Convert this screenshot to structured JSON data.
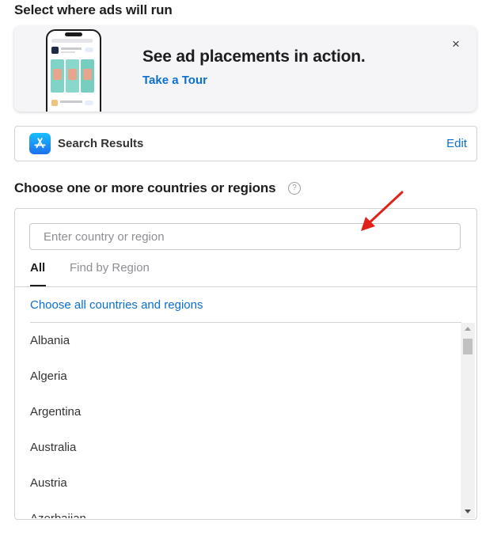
{
  "header": {
    "title": "Select where ads will run"
  },
  "promo": {
    "headline": "See ad placements in action.",
    "link": "Take a Tour",
    "close_icon": "×"
  },
  "placement": {
    "icon": "app-store-icon",
    "label": "Search Results",
    "edit": "Edit"
  },
  "countries": {
    "title": "Choose one or more countries or regions",
    "help_icon": "?",
    "search": {
      "placeholder": "Enter country or region",
      "value": ""
    },
    "tabs": [
      {
        "label": "All",
        "active": true
      },
      {
        "label": "Find by Region",
        "active": false
      }
    ],
    "choose_all": "Choose all countries and regions",
    "items": [
      "Albania",
      "Algeria",
      "Argentina",
      "Australia",
      "Austria",
      "Azerbaijan"
    ]
  },
  "colors": {
    "link": "#0a6fd0",
    "annotation": "#e0221b"
  }
}
